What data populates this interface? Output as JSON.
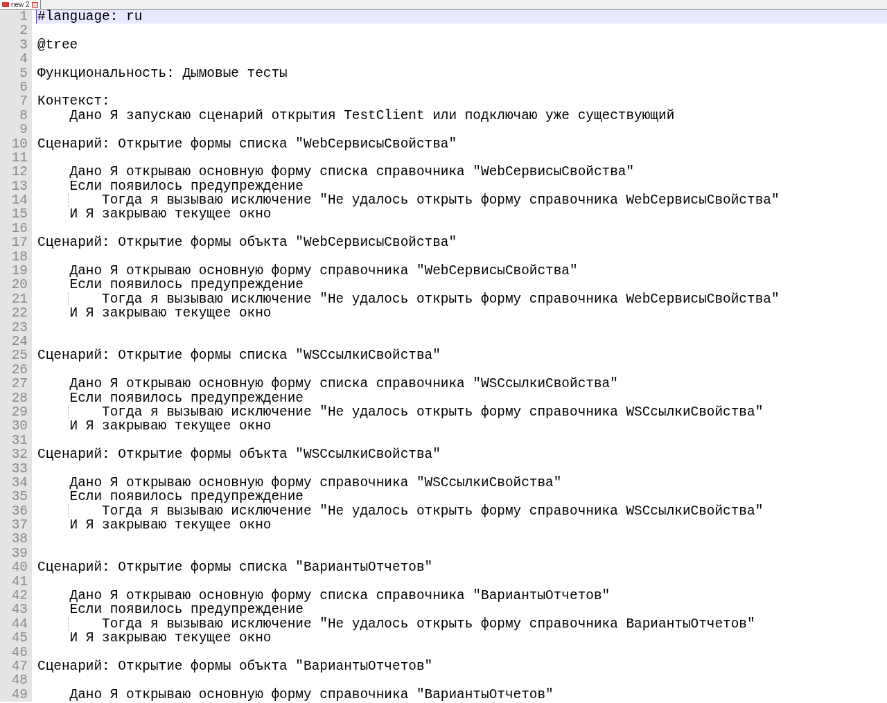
{
  "tabs": [
    {
      "label": "new 2",
      "selected": true
    }
  ],
  "lines": [
    {
      "number": "1",
      "text": "#language: ru",
      "current": true
    },
    {
      "number": "2"
    },
    {
      "number": "3",
      "text": "@tree"
    },
    {
      "number": "4"
    },
    {
      "number": "5",
      "text": "Функциональность: Дымовые тесты"
    },
    {
      "number": "6"
    },
    {
      "number": "7",
      "text": "Контекст:"
    },
    {
      "number": "8",
      "text": "    Дано Я запускаю сценарий открытия TestClient или подключаю уже существующий"
    },
    {
      "number": "9"
    },
    {
      "number": "10",
      "text": "Сценарий: Открытие формы списка \"WebСервисыСвойства\""
    },
    {
      "number": "11"
    },
    {
      "number": "12",
      "text": "    Дано Я открываю основную форму списка справочника \"WebСервисыСвойства\""
    },
    {
      "number": "13",
      "text": "    Если появилось предупреждение"
    },
    {
      "number": "14",
      "text": "        Тогда я вызываю исключение \"Не удалось открыть форму справочника WebСервисыСвойства\"",
      "guide": true
    },
    {
      "number": "15",
      "text": "    И Я закрываю текущее окно"
    },
    {
      "number": "16"
    },
    {
      "number": "17",
      "text": "Сценарий: Открытие формы объкта \"WebСервисыСвойства\""
    },
    {
      "number": "18"
    },
    {
      "number": "19",
      "text": "    Дано Я открываю основную форму справочника \"WebСервисыСвойства\""
    },
    {
      "number": "20",
      "text": "    Если появилось предупреждение"
    },
    {
      "number": "21",
      "text": "        Тогда я вызываю исключение \"Не удалось открыть форму справочника WebСервисыСвойства\"",
      "guide": true
    },
    {
      "number": "22",
      "text": "    И Я закрываю текущее окно"
    },
    {
      "number": "23"
    },
    {
      "number": "24"
    },
    {
      "number": "25",
      "text": "Сценарий: Открытие формы списка \"WSСсылкиСвойства\""
    },
    {
      "number": "26"
    },
    {
      "number": "27",
      "text": "    Дано Я открываю основную форму списка справочника \"WSСсылкиСвойства\""
    },
    {
      "number": "28",
      "text": "    Если появилось предупреждение"
    },
    {
      "number": "29",
      "text": "        Тогда я вызываю исключение \"Не удалось открыть форму справочника WSСсылкиСвойства\"",
      "guide": true
    },
    {
      "number": "30",
      "text": "    И Я закрываю текущее окно"
    },
    {
      "number": "31"
    },
    {
      "number": "32",
      "text": "Сценарий: Открытие формы объкта \"WSСсылкиСвойства\""
    },
    {
      "number": "33"
    },
    {
      "number": "34",
      "text": "    Дано Я открываю основную форму справочника \"WSСсылкиСвойства\""
    },
    {
      "number": "35",
      "text": "    Если появилось предупреждение"
    },
    {
      "number": "36",
      "text": "        Тогда я вызываю исключение \"Не удалось открыть форму справочника WSСсылкиСвойства\"",
      "guide": true
    },
    {
      "number": "37",
      "text": "    И Я закрываю текущее окно"
    },
    {
      "number": "38"
    },
    {
      "number": "39"
    },
    {
      "number": "40",
      "text": "Сценарий: Открытие формы списка \"ВариантыОтчетов\""
    },
    {
      "number": "41"
    },
    {
      "number": "42",
      "text": "    Дано Я открываю основную форму списка справочника \"ВариантыОтчетов\""
    },
    {
      "number": "43",
      "text": "    Если появилось предупреждение"
    },
    {
      "number": "44",
      "text": "        Тогда я вызываю исключение \"Не удалось открыть форму справочника ВариантыОтчетов\"",
      "guide": true
    },
    {
      "number": "45",
      "text": "    И Я закрываю текущее окно"
    },
    {
      "number": "46"
    },
    {
      "number": "47",
      "text": "Сценарий: Открытие формы объкта \"ВариантыОтчетов\""
    },
    {
      "number": "48"
    },
    {
      "number": "49",
      "text": "    Дано Я открываю основную форму справочника \"ВариантыОтчетов\""
    }
  ]
}
